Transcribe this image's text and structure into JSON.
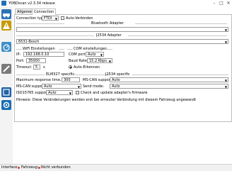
{
  "window": {
    "title": "YOBDscan v2.3.34 release",
    "minimize": "–",
    "maximize": "□",
    "close": "✕"
  },
  "toolbar": [
    "car-icon",
    "warning-icon",
    "gauge-icon",
    "tools-icon",
    "can-icon",
    "settings-icon"
  ],
  "tabs": [
    {
      "label": "Allgemein"
    },
    {
      "label": "Connection"
    }
  ],
  "connection": {
    "type_label": "Connection type:",
    "type_value": "FTDI",
    "auto_connect_label": "Auto-Verbinden",
    "bluetooth_adapter_title": "Bluetooth Adapter",
    "bluetooth_adapter_value": "",
    "j2534_adapter_title": "J2534 Adapter",
    "j2534_adapter_value": "6531-Bosch",
    "wifi": {
      "title": "WiFi Einstellungen",
      "ip_label": "IP:",
      "ip_value": "192.168.0.10",
      "port_label": "Port:",
      "port_value": "35000",
      "timeout_label": "Timeout:",
      "timeout_value": "5",
      "timeout_unit": "s"
    },
    "com": {
      "title": "COM einstellungen",
      "port_label": "COM port:",
      "port_value": "Auto",
      "baud_label": "Baud Rate:",
      "baud_value": "15.2 Kbps",
      "auto_detect_label": "Auto-Erkennen"
    },
    "elm327": {
      "title": "ELM327 specific",
      "max_response_label": "Maximum response time, ms:",
      "max_response_value": "300",
      "ms_can_label": "MS-CAN support:",
      "ms_can_value": "Auto"
    },
    "j2534": {
      "title": "J2534 specific",
      "ms_can_label": "MS-CAN support:",
      "ms_can_value": "Auto",
      "send_mode_label": "Send mode:",
      "send_mode_value": "Auto"
    },
    "iso15765_label": "ISO15765 support:",
    "iso15765_value": "Auto",
    "firmware_check_label": "Check and update adapter's firmware",
    "hint": "Hinweis: Diese Veränderungen werden erst bei erneuter Verbindung mit diesem Fahrzeug angewandt"
  },
  "statusbar": {
    "interface_label": "Interface:",
    "vehicle_label": "Fahrzeug:",
    "connection_status": "Nicht verbunden"
  }
}
